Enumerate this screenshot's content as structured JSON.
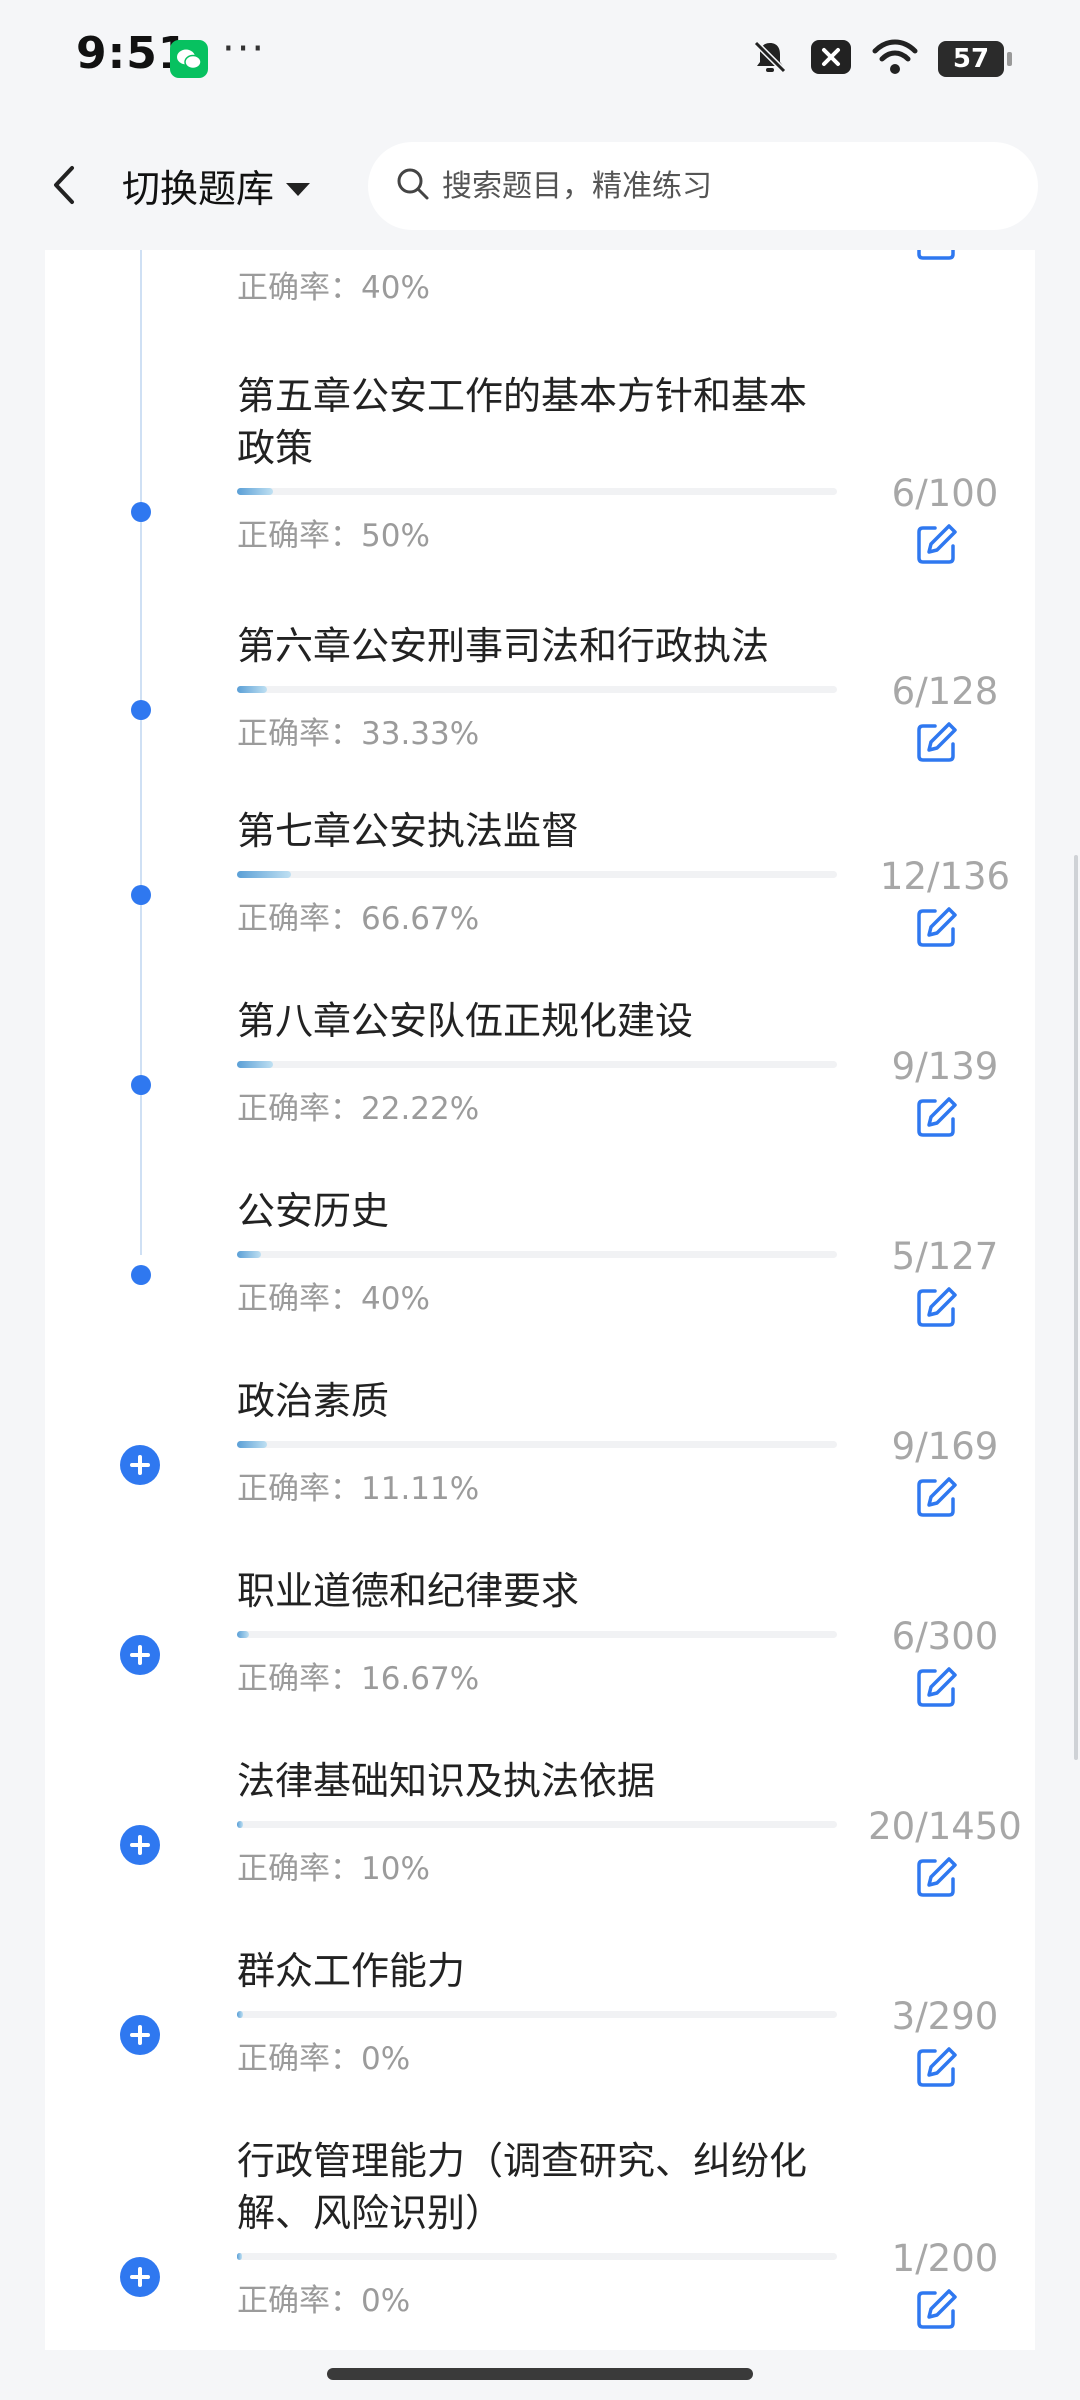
{
  "status": {
    "time": "9:51",
    "more": "···",
    "battery": "57",
    "icons": [
      "wechat-icon",
      "bell-muted-icon",
      "close-notification-icon",
      "wifi-icon",
      "battery-icon"
    ]
  },
  "header": {
    "switch_label": "切换题库",
    "search_placeholder": "搜索题目，精准练习"
  },
  "colors": {
    "accent": "#2f78f0",
    "muted_text": "#9b9b9b",
    "count_text": "#a7a7a7"
  },
  "accuracy_prefix": "正确率：",
  "chapters": [
    {
      "title": "",
      "accuracy": "40%",
      "count": "",
      "progress": 0.09,
      "marker": "none"
    },
    {
      "title": "第五章公安工作的基本方针和基本政策",
      "accuracy": "50%",
      "count": "6/100",
      "progress": 0.06,
      "marker": "dot"
    },
    {
      "title": "第六章公安刑事司法和行政执法",
      "accuracy": "33.33%",
      "count": "6/128",
      "progress": 0.05,
      "marker": "dot"
    },
    {
      "title": "第七章公安执法监督",
      "accuracy": "66.67%",
      "count": "12/136",
      "progress": 0.09,
      "marker": "dot"
    },
    {
      "title": "第八章公安队伍正规化建设",
      "accuracy": "22.22%",
      "count": "9/139",
      "progress": 0.06,
      "marker": "dot"
    },
    {
      "title": "公安历史",
      "accuracy": "40%",
      "count": "5/127",
      "progress": 0.04,
      "marker": "dot"
    },
    {
      "title": "政治素质",
      "accuracy": "11.11%",
      "count": "9/169",
      "progress": 0.05,
      "marker": "plus"
    },
    {
      "title": "职业道德和纪律要求",
      "accuracy": "16.67%",
      "count": "6/300",
      "progress": 0.02,
      "marker": "plus"
    },
    {
      "title": "法律基础知识及执法依据",
      "accuracy": "10%",
      "count": "20/1450",
      "progress": 0.01,
      "marker": "plus"
    },
    {
      "title": "群众工作能力",
      "accuracy": "0%",
      "count": "3/290",
      "progress": 0.01,
      "marker": "plus"
    },
    {
      "title": "行政管理能力（调查研究、纠纷化解、风险识别）",
      "accuracy": "0%",
      "count": "1/200",
      "progress": 0.005,
      "marker": "plus"
    }
  ]
}
